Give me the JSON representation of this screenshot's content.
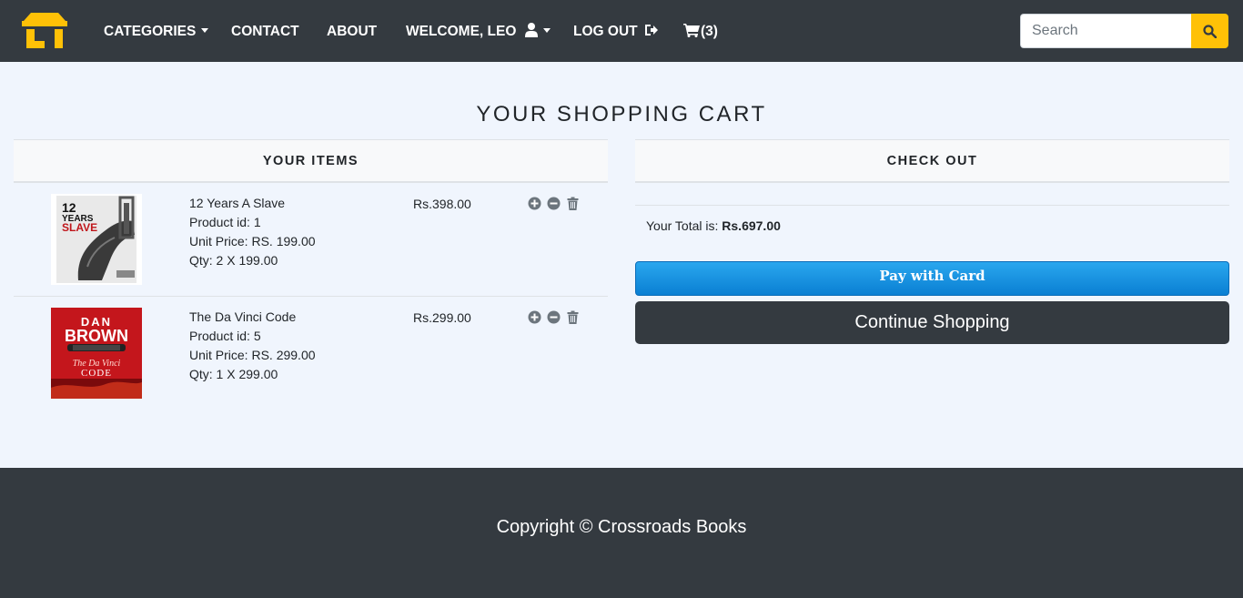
{
  "nav": {
    "categories": "CATEGORIES",
    "contact": "CONTACT",
    "about": "ABOUT",
    "welcome": "WELCOME, LEO",
    "logout": "LOG OUT",
    "cart_count": "(3)",
    "search_placeholder": "Search",
    "brand_color": "#ffc107"
  },
  "page": {
    "title": "YOUR SHOPPING CART"
  },
  "cart": {
    "heading": "YOUR ITEMS",
    "items": [
      {
        "name": "12 Years A Slave",
        "product_id": "Product id: 1",
        "unit_price": "Unit Price: RS. 199.00",
        "qty": "Qty: 2 X 199.00",
        "line_total": "Rs.398.00",
        "cover": {
          "line1": "12",
          "line2": "YEARS",
          "line3": "SLAVE"
        }
      },
      {
        "name": "The Da Vinci Code",
        "product_id": "Product id: 5",
        "unit_price": "Unit Price: RS. 299.00",
        "qty": "Qty: 1 X 299.00",
        "line_total": "Rs.299.00",
        "cover": {
          "line1": "DAN",
          "line2": "BROWN",
          "line3": "The Da Vinci",
          "line4": "CODE"
        }
      }
    ]
  },
  "checkout": {
    "heading": "CHECK OUT",
    "total_label": "Your Total is: ",
    "total_value": "Rs.697.00",
    "pay_label": "Pay with Card",
    "continue_label": "Continue Shopping"
  },
  "footer": {
    "copyright": "Copyright © Crossroads Books"
  }
}
